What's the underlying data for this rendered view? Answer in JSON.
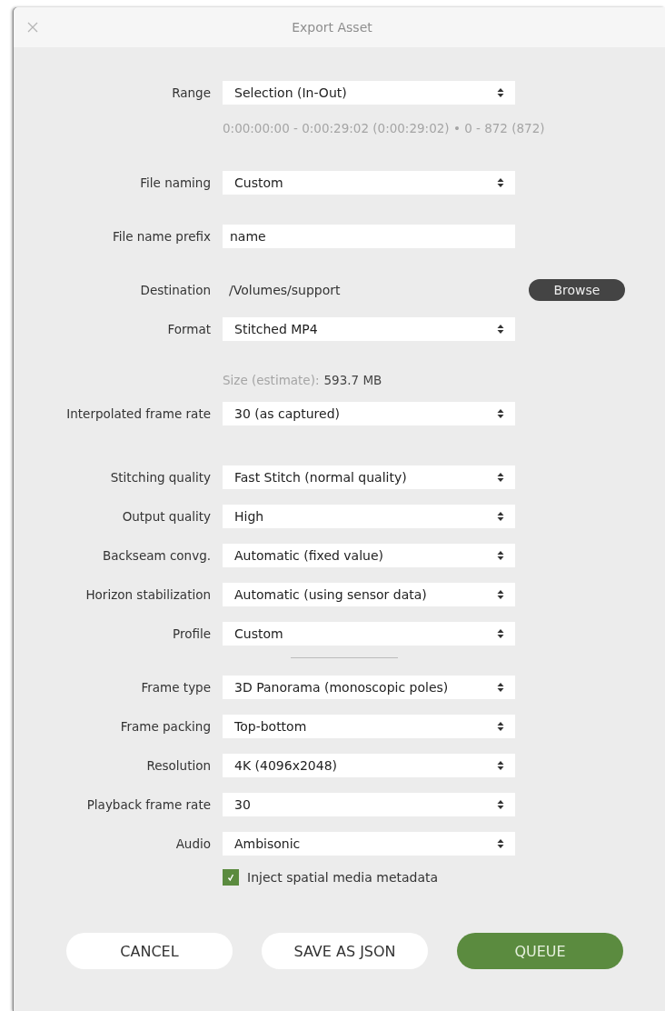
{
  "window": {
    "title": "Export Asset"
  },
  "sections": [
    {
      "rows": [
        {
          "kind": "select",
          "label": "Range",
          "value": "Selection (In-Out)"
        },
        {
          "kind": "note",
          "text": "0:00:00:00 - 0:00:29:02 (0:00:29:02) • 0 - 872 (872)"
        }
      ]
    },
    {
      "rows": [
        {
          "kind": "select",
          "label": "File naming",
          "value": "Custom"
        }
      ]
    },
    {
      "rows": [
        {
          "kind": "input",
          "label": "File name prefix",
          "value": "name"
        }
      ]
    },
    {
      "rows": [
        {
          "kind": "path",
          "label": "Destination",
          "value": "/Volumes/support",
          "button": "Browse"
        },
        {
          "kind": "select",
          "label": "Format",
          "value": "Stitched MP4"
        },
        {
          "kind": "estimate",
          "text": "Size (estimate):",
          "value": "593.7 MB"
        },
        {
          "kind": "select",
          "label": "Interpolated frame rate",
          "value": "30 (as captured)"
        }
      ]
    },
    {
      "rows": [
        {
          "kind": "select",
          "label": "Stitching quality",
          "value": "Fast Stitch (normal quality)"
        },
        {
          "kind": "select",
          "label": "Output quality",
          "value": "High"
        },
        {
          "kind": "select",
          "label": "Backseam convg.",
          "value": "Automatic (fixed value)"
        },
        {
          "kind": "select",
          "label": "Horizon stabilization",
          "value": "Automatic (using sensor data)"
        },
        {
          "kind": "select",
          "label": "Profile",
          "value": "Custom"
        },
        {
          "kind": "divider"
        },
        {
          "kind": "select",
          "label": "Frame type",
          "value": "3D Panorama (monoscopic poles)"
        },
        {
          "kind": "select",
          "label": "Frame packing",
          "value": "Top-bottom"
        },
        {
          "kind": "select",
          "label": "Resolution",
          "value": "4K (4096x2048)"
        },
        {
          "kind": "select",
          "label": "Playback frame rate",
          "value": "30"
        },
        {
          "kind": "select",
          "label": "Audio",
          "value": "Ambisonic"
        },
        {
          "kind": "checkbox",
          "label": "Inject spatial media metadata",
          "checked": true
        }
      ]
    }
  ],
  "buttons": [
    {
      "label": "CANCEL",
      "primary": false
    },
    {
      "label": "SAVE AS JSON",
      "primary": false
    },
    {
      "label": "QUEUE",
      "primary": true
    }
  ]
}
